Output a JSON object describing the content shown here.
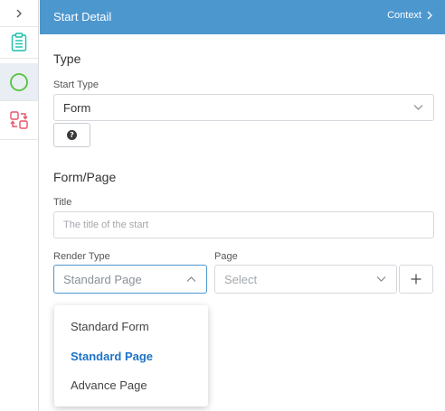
{
  "header": {
    "title": "Start Detail",
    "context_label": "Context"
  },
  "type_section": {
    "title": "Type",
    "start_type_label": "Start Type",
    "start_type_value": "Form"
  },
  "form_section": {
    "title": "Form/Page",
    "title_label": "Title",
    "title_placeholder": "The title of the start",
    "render_type_label": "Render Type",
    "render_type_value": "Standard Page",
    "page_label": "Page",
    "page_placeholder": "Select"
  },
  "render_type_menu": {
    "options": [
      "Standard Form",
      "Standard Page",
      "Advance Page"
    ],
    "selected": "Standard Page"
  },
  "colors": {
    "header_bg": "#4d97cf",
    "rail_active_bg": "#e8eef3",
    "doc_icon": "#1bbfa8",
    "start_icon": "#52c23c",
    "swap_icon": "#e8536a",
    "selected_option": "#1e73c6"
  },
  "icons": {
    "rail_expand": "chevron-right-icon",
    "rail_doc": "document-list-icon",
    "rail_start": "start-circle-icon",
    "rail_swap": "swap-icon"
  }
}
